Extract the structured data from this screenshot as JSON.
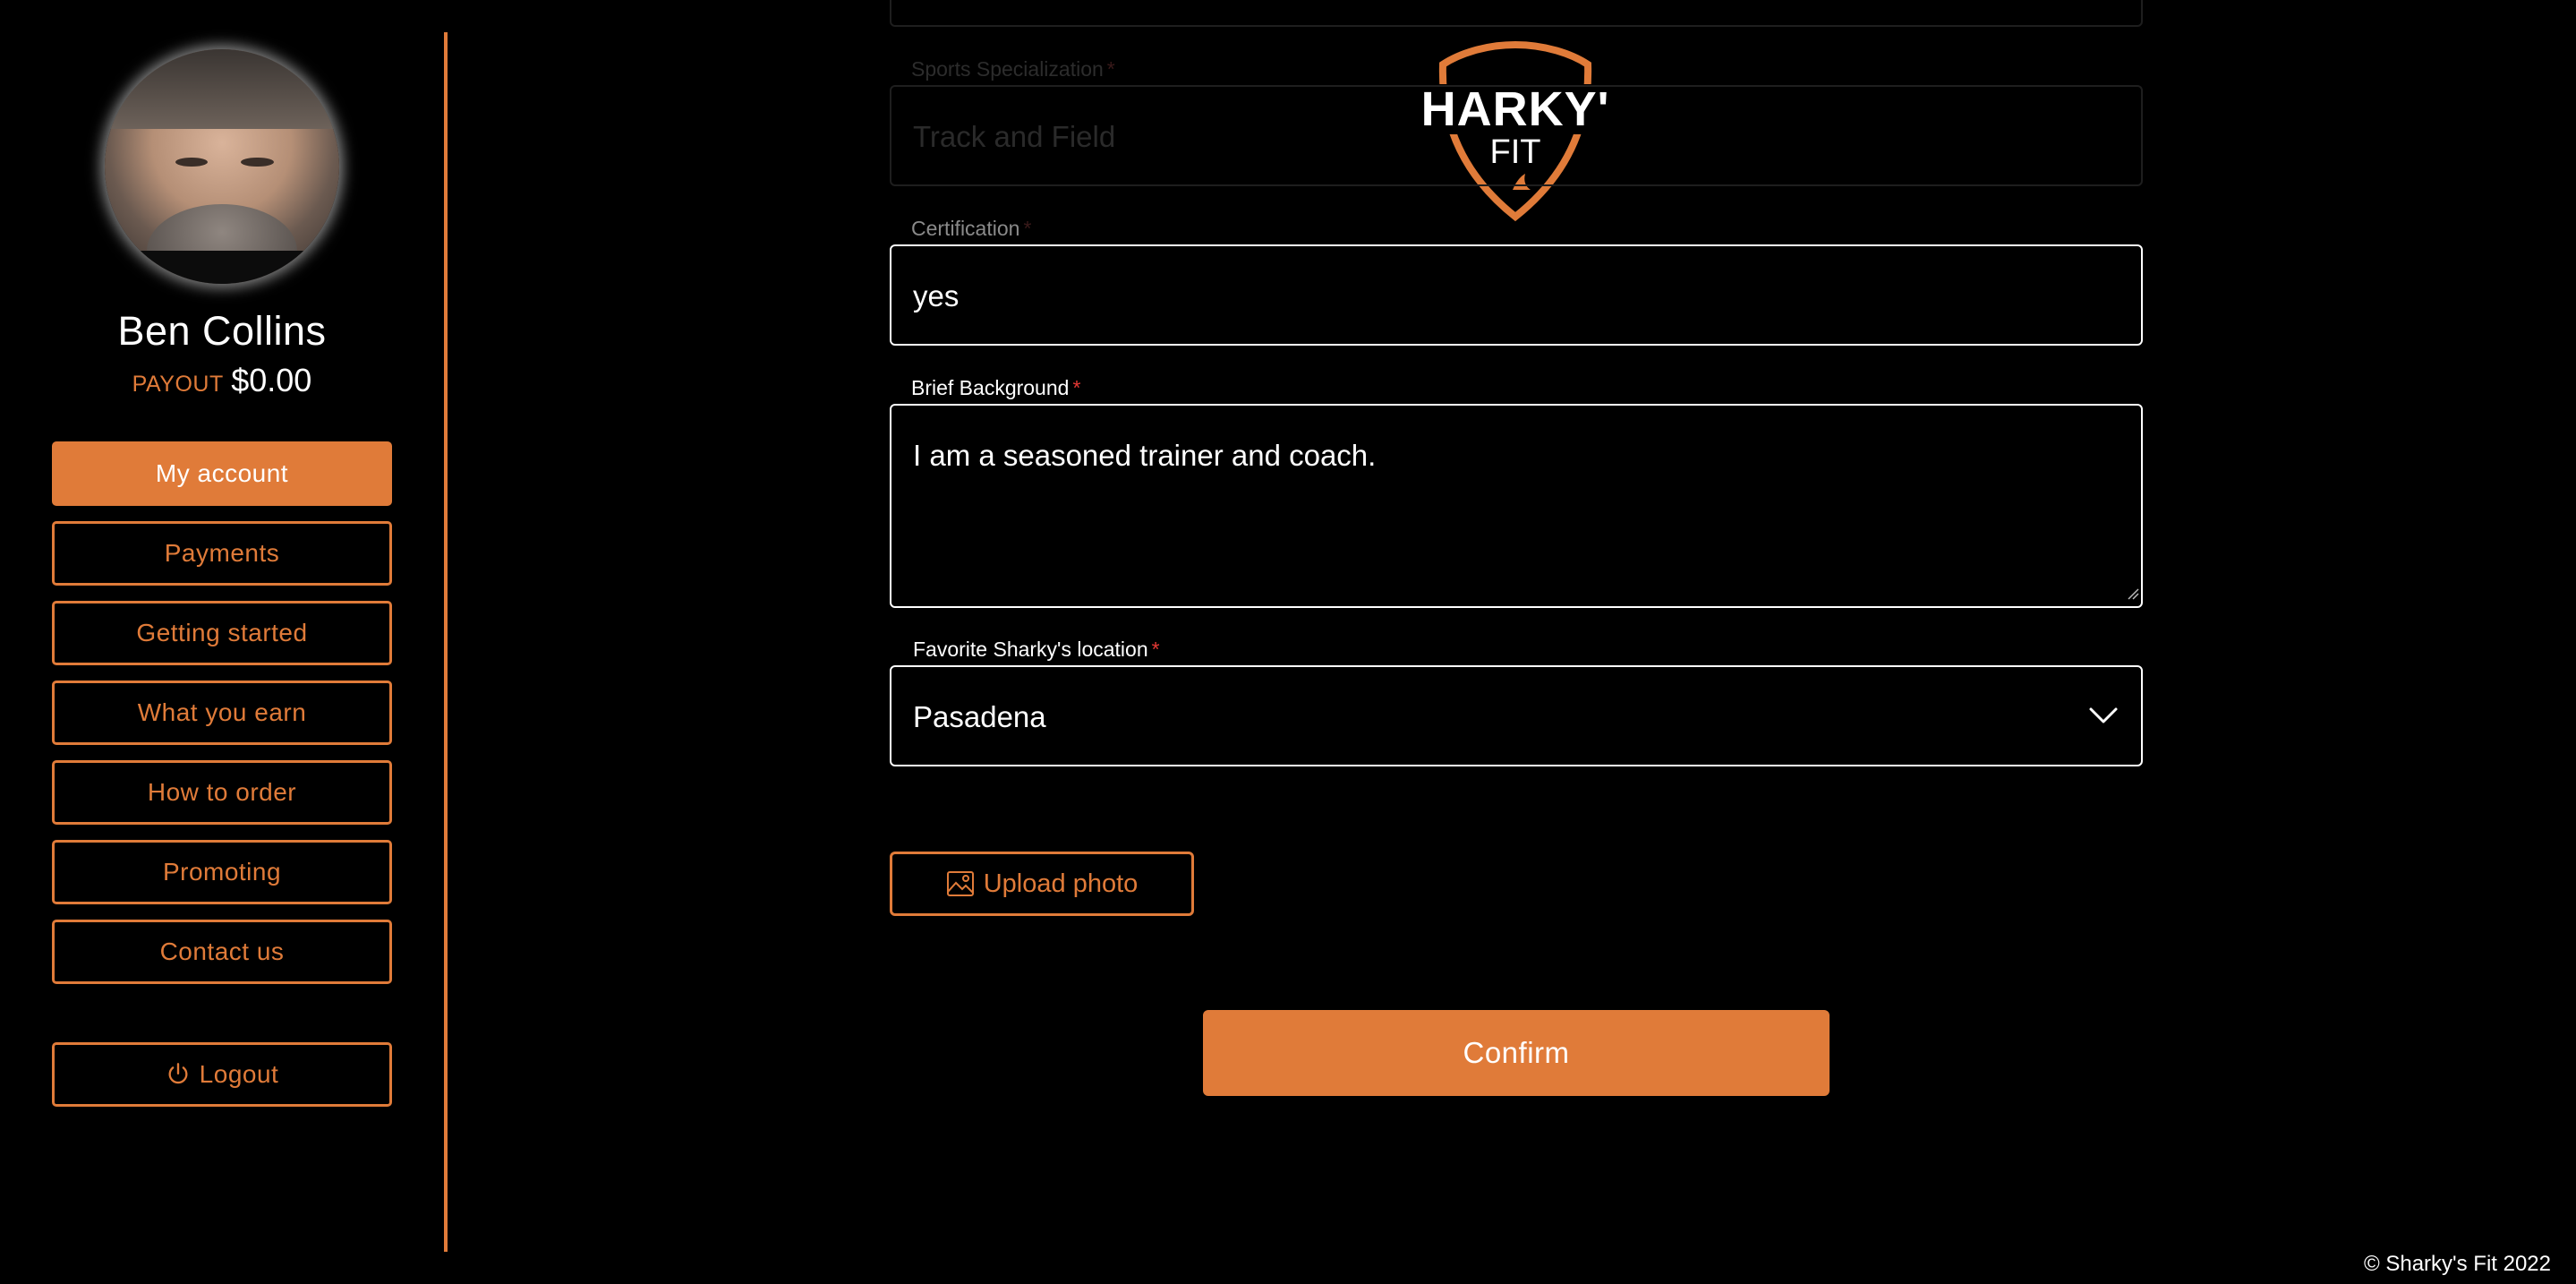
{
  "user": {
    "name": "Ben Collins",
    "payout_label": "PAYOUT",
    "payout_amount": "$0.00"
  },
  "nav": {
    "items": [
      {
        "label": "My account",
        "active": true
      },
      {
        "label": "Payments"
      },
      {
        "label": "Getting started"
      },
      {
        "label": "What you earn"
      },
      {
        "label": "How to order"
      },
      {
        "label": "Promoting"
      },
      {
        "label": "Contact us"
      }
    ],
    "logout": "Logout"
  },
  "logo": {
    "line1": "SHARKY'S",
    "line2": "FIT"
  },
  "form": {
    "sports_specialization": {
      "label": "Sports Specialization",
      "required": "*",
      "value": "Track and Field"
    },
    "certification": {
      "label": "Certification",
      "required": "*",
      "value": "yes"
    },
    "brief_background": {
      "label": "Brief Background",
      "required": "*",
      "value": "I am a seasoned trainer and coach."
    },
    "favorite_location": {
      "label": "Favorite Sharky's location",
      "required": "*",
      "value": "Pasadena"
    },
    "upload_label": "Upload photo",
    "confirm_label": "Confirm"
  },
  "footer": "© Sharky's Fit 2022",
  "colors": {
    "accent": "#e07b39",
    "background": "#000000",
    "required": "#e53935"
  },
  "icons": [
    "power-icon",
    "image-icon",
    "chevron-down-icon",
    "resize-handle-icon"
  ]
}
